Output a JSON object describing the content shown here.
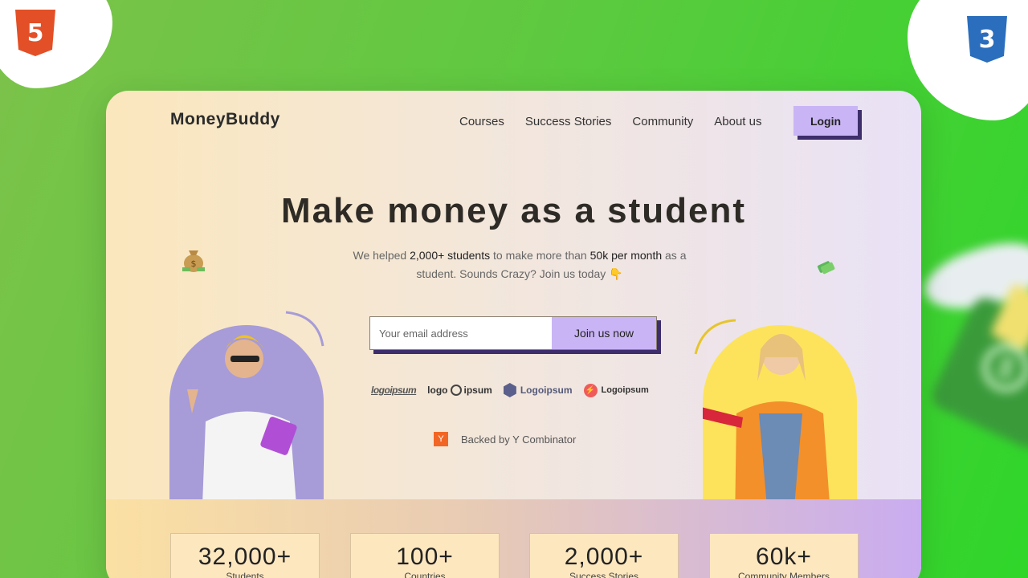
{
  "corner_badges": {
    "left_icon": "html5-icon",
    "left_glyph": "5",
    "right_icon": "css3-icon",
    "right_glyph": "3"
  },
  "brand": "MoneyBuddy",
  "nav": {
    "links": [
      "Courses",
      "Success Stories",
      "Community",
      "About us"
    ],
    "login_label": "Login"
  },
  "hero": {
    "title": "Make money as a student",
    "subtitle_parts": [
      "We helped ",
      "2,000+ students",
      " to make more than ",
      "50k per month",
      " as a student. Sounds Crazy? Join us today ",
      "👇"
    ]
  },
  "signup": {
    "placeholder": "Your email address",
    "button_label": "Join us now"
  },
  "partner_logos": [
    "logoipsum",
    "logo",
    "ipsum",
    "Logoipsum",
    "Logoipsum"
  ],
  "backing": {
    "logo_letter": "Y",
    "text": "Backed by Y Combinator"
  },
  "stats": [
    {
      "value": "32,000+",
      "label": "Students"
    },
    {
      "value": "100+",
      "label": "Countries"
    },
    {
      "value": "2,000+",
      "label": "Success Stories"
    },
    {
      "value": "60k+",
      "label": "Community Members"
    }
  ],
  "colors": {
    "accent": "#c9b5f5",
    "shadow": "#3d2d6b",
    "arch_left": "#a79bd8",
    "arch_right": "#fde35c"
  }
}
